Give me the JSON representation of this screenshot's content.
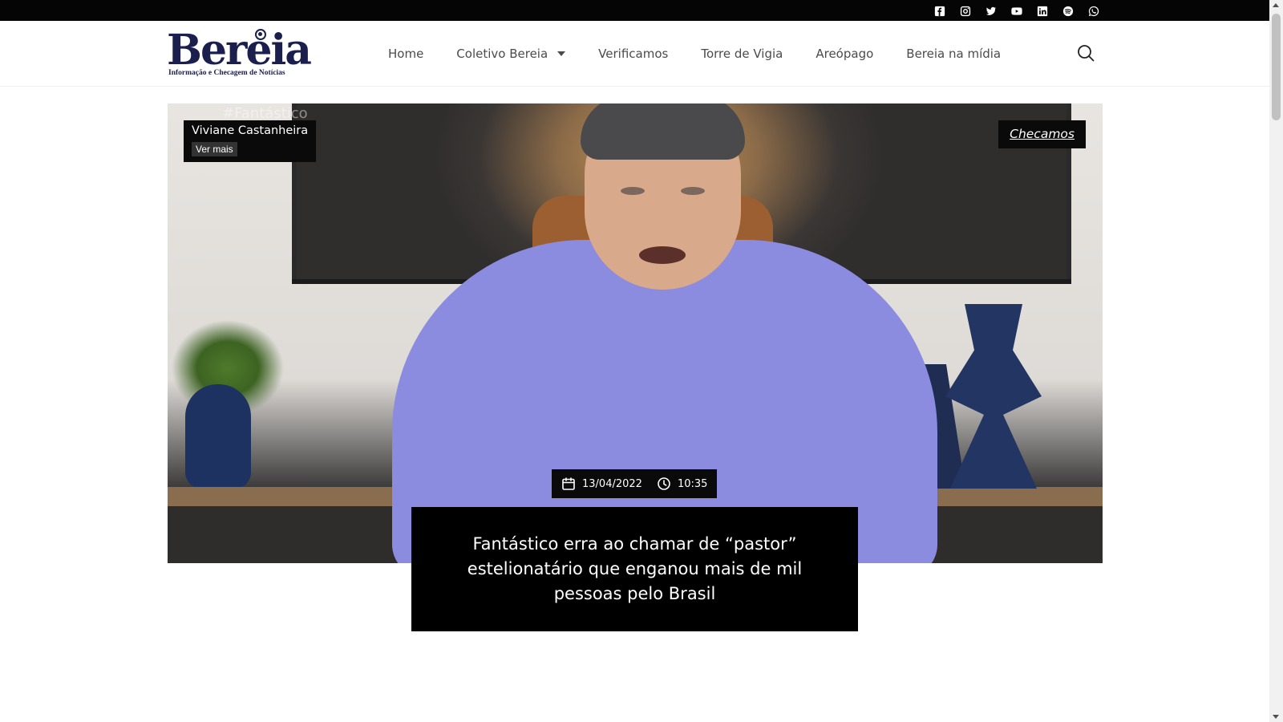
{
  "social": {
    "icons": [
      "facebook-icon",
      "instagram-icon",
      "twitter-icon",
      "youtube-icon",
      "linkedin-icon",
      "spotify-icon",
      "whatsapp-icon"
    ]
  },
  "header": {
    "logo_text": "Bereia",
    "logo_tagline": "Informação e Checagem de Notícias",
    "nav": [
      {
        "label": "Home"
      },
      {
        "label": "Coletivo Bereia",
        "has_dropdown": true
      },
      {
        "label": "Verificamos"
      },
      {
        "label": "Torre de Vigia"
      },
      {
        "label": "Areópago"
      },
      {
        "label": "Bereia na mídia"
      }
    ],
    "search_icon": "search-icon"
  },
  "hero": {
    "image_hashtag": "#Fantástico",
    "author_name": "Viviane Castanheira",
    "author_more": "Ver mais",
    "category": "Checamos",
    "date": "13/04/2022",
    "time": "10:35",
    "title": "Fantástico erra ao chamar de “pastor” estelionatário que enganou mais de mil pessoas pelo Brasil"
  },
  "colors": {
    "brand": "#1b1f4e",
    "topbar": "#050505",
    "nav_text": "#4b4b4b",
    "overlay": "#000000"
  }
}
